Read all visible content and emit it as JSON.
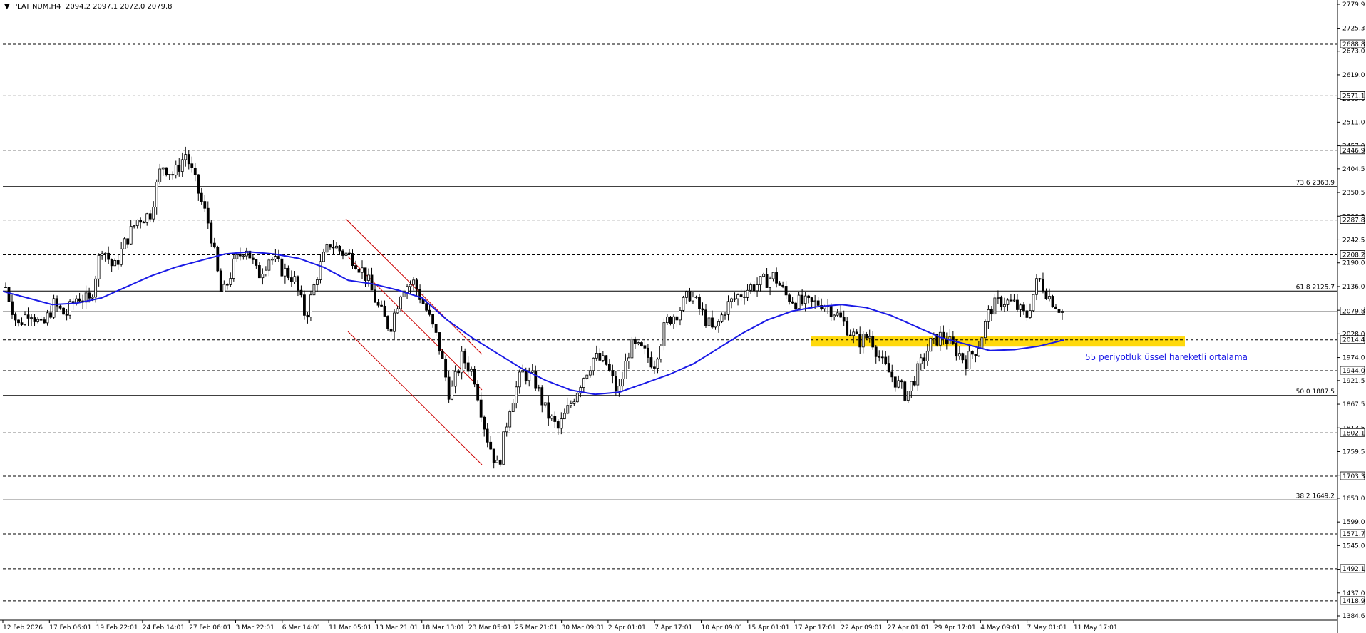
{
  "chart_data": {
    "type": "candlestick",
    "header": {
      "symbol": "PLATINUM,H4",
      "ohlc": "2094.2 2097.1 2072.0 2079.8"
    },
    "ylim": [
      1384.6,
      2779.9
    ],
    "y_ticks": [
      "2779.9",
      "2725.3",
      "2673.0",
      "2619.0",
      "2565.0",
      "2511.0",
      "2457.0",
      "2404.5",
      "2350.5",
      "2296.5",
      "2242.5",
      "2190.0",
      "2136.0",
      "2082.0",
      "2028.0",
      "1974.0",
      "1921.5",
      "1867.5",
      "1813.5",
      "1759.5",
      "1705.5",
      "1653.0",
      "1599.0",
      "1545.0",
      "1491.0",
      "1437.0",
      "1384.6"
    ],
    "x_ticks": [
      "12 Feb 2026",
      "17 Feb 06:01",
      "19 Feb 22:01",
      "24 Feb 14:01",
      "27 Feb 06:01",
      "3 Mar 22:01",
      "6 Mar 14:01",
      "11 Mar 05:01",
      "13 Mar 21:01",
      "18 Mar 13:01",
      "23 Mar 05:01",
      "25 Mar 21:01",
      "30 Mar 09:01",
      "2 Apr 01:01",
      "7 Apr 17:01",
      "10 Apr 09:01",
      "15 Apr 01:01",
      "17 Apr 17:01",
      "22 Apr 09:01",
      "27 Apr 01:01",
      "29 Apr 17:01",
      "4 May 09:01",
      "7 May 01:01",
      "11 May 17:01"
    ],
    "price_levels": [
      {
        "value": 2688.8,
        "label": "2688.8",
        "style": "dashed"
      },
      {
        "value": 2571.1,
        "label": "2571.1",
        "style": "dashed"
      },
      {
        "value": 2446.9,
        "label": "2446.9",
        "style": "dashed"
      },
      {
        "value": 2287.8,
        "label": "2287.8",
        "style": "dashed"
      },
      {
        "value": 2208.2,
        "label": "2208.2",
        "style": "dashed"
      },
      {
        "value": 2014.4,
        "label": "2014.4",
        "style": "dashed"
      },
      {
        "value": 1944.0,
        "label": "1944.0",
        "style": "dashed"
      },
      {
        "value": 1802.1,
        "label": "1802.1",
        "style": "dashed"
      },
      {
        "value": 1703.3,
        "label": "1703.3",
        "style": "dashed"
      },
      {
        "value": 1571.7,
        "label": "1571.7",
        "style": "dashed"
      },
      {
        "value": 1492.1,
        "label": "1492.1",
        "style": "dashed"
      },
      {
        "value": 1418.9,
        "label": "1418.9",
        "style": "dashed"
      }
    ],
    "fib_levels": [
      {
        "value": 2363.9,
        "label": "73.6 2363.9"
      },
      {
        "value": 2125.7,
        "label": "61.8 2125.7"
      },
      {
        "value": 1887.5,
        "label": "50.0 1887.5"
      },
      {
        "value": 1649.2,
        "label": "38.2 1649.2"
      }
    ],
    "current_price": {
      "value": 2079.8,
      "label": "2079.8"
    },
    "zone": {
      "from": 1999.0,
      "to": 2022.0,
      "color": "#ffd700"
    },
    "ma_label": "55 periyotluk üssel hareketli ortalama",
    "colors": {
      "ma": "#1a1ae6",
      "channel": "#cc0000",
      "candle": "#000000",
      "grid": "#000000"
    },
    "price_path": [
      2135,
      2045,
      2085,
      2040,
      2095,
      2070,
      2115,
      2100,
      2230,
      2175,
      2240,
      2290,
      2300,
      2415,
      2390,
      2440,
      2355,
      2270,
      2110,
      2185,
      2230,
      2160,
      2205,
      2175,
      2155,
      2065,
      2170,
      2235,
      2215,
      2200,
      2160,
      2090,
      2040,
      2135,
      2145,
      2085,
      2010,
      1885,
      1975,
      1935,
      1800,
      1720,
      1865,
      1940,
      1925,
      1850,
      1810,
      1865,
      1925,
      1975,
      1960,
      1890,
      2000,
      1990,
      1960,
      2055,
      2080,
      2120,
      2075,
      2030,
      2090,
      2115,
      2135,
      2145,
      2160,
      2115,
      2100,
      2095,
      2100,
      2080,
      2045,
      2010,
      2025,
      1960,
      1925,
      1888,
      1945,
      2005,
      2025,
      1995,
      1965,
      2000,
      2085,
      2105,
      2095,
      2065,
      2155,
      2110,
      2079.8
    ],
    "ma_path": [
      2125,
      2110,
      2095,
      2098,
      2110,
      2135,
      2160,
      2180,
      2195,
      2210,
      2215,
      2210,
      2200,
      2180,
      2150,
      2142,
      2128,
      2110,
      2060,
      2020,
      1985,
      1950,
      1922,
      1900,
      1890,
      1895,
      1915,
      1935,
      1960,
      1995,
      2030,
      2060,
      2080,
      2090,
      2095,
      2088,
      2070,
      2045,
      2020,
      2005,
      1990,
      1992,
      2000,
      2014
    ]
  }
}
